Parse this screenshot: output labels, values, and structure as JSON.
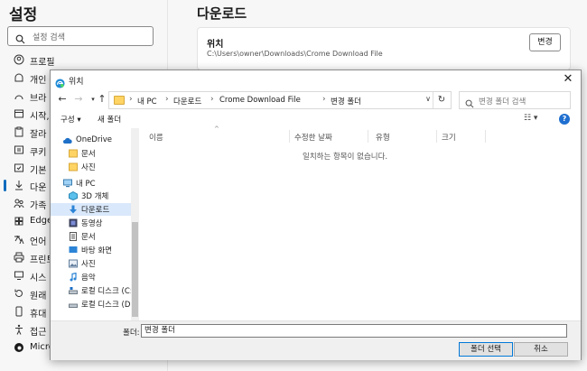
{
  "settings": {
    "title": "설정",
    "search_placeholder": "설정 검색",
    "nav": [
      {
        "label": "프로필",
        "icon": "profile-icon"
      },
      {
        "label": "개인",
        "icon": "privacy-icon"
      },
      {
        "label": "브라",
        "icon": "browser-icon"
      },
      {
        "label": "시작,",
        "icon": "startup-icon"
      },
      {
        "label": "잘라",
        "icon": "clipboard-icon"
      },
      {
        "label": "쿠키",
        "icon": "cookie-icon"
      },
      {
        "label": "기본",
        "icon": "default-browser-icon"
      },
      {
        "label": "다운",
        "icon": "download-icon"
      },
      {
        "label": "가족",
        "icon": "family-icon"
      },
      {
        "label": "Edge",
        "icon": "edge-bar-icon"
      },
      {
        "label": "언어",
        "icon": "language-icon"
      },
      {
        "label": "프린트",
        "icon": "printer-icon"
      },
      {
        "label": "시스",
        "icon": "system-icon"
      },
      {
        "label": "원래",
        "icon": "reset-icon"
      },
      {
        "label": "휴대",
        "icon": "phone-icon"
      },
      {
        "label": "접근",
        "icon": "accessibility-icon"
      },
      {
        "label": "Micro",
        "icon": "edge-logo-icon"
      }
    ],
    "main_title": "다운로드",
    "location_label": "위치",
    "location_path": "C:\\Users\\owner\\Downloads\\Crome Download File",
    "change_button": "변경"
  },
  "dialog": {
    "title": "위치",
    "breadcrumbs": [
      "내 PC",
      "다운로드",
      "Crome Download File",
      "변경 폴더"
    ],
    "search_placeholder": "변경 폴더 검색",
    "organize": "구성 ▾",
    "new_folder": "새 폴더",
    "tree": [
      {
        "label": "OneDrive",
        "icon": "cloud-icon"
      },
      {
        "label": "문서",
        "icon": "folder-icon"
      },
      {
        "label": "사진",
        "icon": "folder-icon"
      },
      {
        "label": "내 PC",
        "icon": "pc-icon"
      },
      {
        "label": "3D 개체",
        "icon": "3d-objects-icon"
      },
      {
        "label": "다운로드",
        "icon": "download-arrow-icon"
      },
      {
        "label": "동영상",
        "icon": "video-icon"
      },
      {
        "label": "문서",
        "icon": "document-icon"
      },
      {
        "label": "바탕 화면",
        "icon": "desktop-icon"
      },
      {
        "label": "사진",
        "icon": "pictures-icon"
      },
      {
        "label": "음악",
        "icon": "music-icon"
      },
      {
        "label": "로컬 디스크 (C:)",
        "icon": "drive-icon"
      },
      {
        "label": "로컬 디스크 (D:)",
        "icon": "drive-icon"
      }
    ],
    "columns": [
      "이름",
      "수정한 날짜",
      "유형",
      "크기"
    ],
    "empty_message": "일치하는 항목이 없습니다.",
    "folder_label": "폴더:",
    "folder_value": "변경 폴더",
    "select_button": "폴더 선택",
    "cancel_button": "취소",
    "accent": "#0078d7"
  }
}
